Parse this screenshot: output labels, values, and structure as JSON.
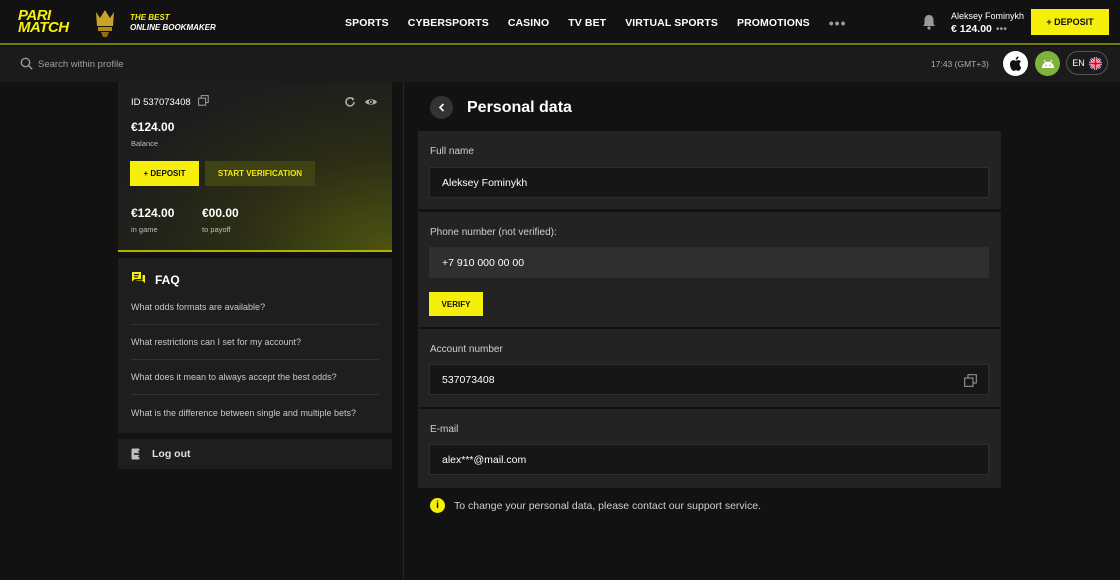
{
  "header": {
    "logo_line1": "PARI",
    "logo_line2": "MATCH",
    "tagline_line1": "THE BEST",
    "tagline_line2": "ONLINE BOOKMAKER",
    "nav": [
      "SPORTS",
      "CYBERSPORTS",
      "CASINO",
      "TV BET",
      "VIRTUAL SPORTS",
      "PROMOTIONS"
    ],
    "more": "•••",
    "user_name": "Aleksey Fominykh",
    "user_balance": "€ 124.00",
    "user_more": "•••",
    "deposit_label": "+ DEPOSIT"
  },
  "subbar": {
    "search_placeholder": "Search within profile",
    "time": "17:43 (GMT+3)",
    "lang": "EN"
  },
  "card": {
    "id": "ID 537073408",
    "balance": "€124.00",
    "balance_label": "Balance",
    "deposit_label": "+ DEPOSIT",
    "verification_label": "START VERIFICATION",
    "in_game": "€124.00",
    "in_game_label": "in game",
    "to_payoff": "€00.00",
    "to_payoff_label": "to payoff"
  },
  "faq": {
    "title": "FAQ",
    "items": [
      "What odds formats are available?",
      "What restrictions can I set for my account?",
      "What does it mean to always accept the best odds?",
      "What is the difference between single and multiple bets?"
    ]
  },
  "logout_label": "Log out",
  "personal": {
    "title": "Personal data",
    "full_name_label": "Full name",
    "full_name": "Aleksey Fominykh",
    "phone_label": "Phone number (not verified):",
    "phone": "+7 910 000 00 00",
    "verify_label": "VERIFY",
    "account_label": "Account number",
    "account": "537073408",
    "email_label": "E-mail",
    "email": "alex***@mail.com",
    "info": "To change your personal data, please contact our support service."
  },
  "colors": {
    "accent": "#f5ef0b",
    "bg": "#121212",
    "panel": "#232323"
  }
}
